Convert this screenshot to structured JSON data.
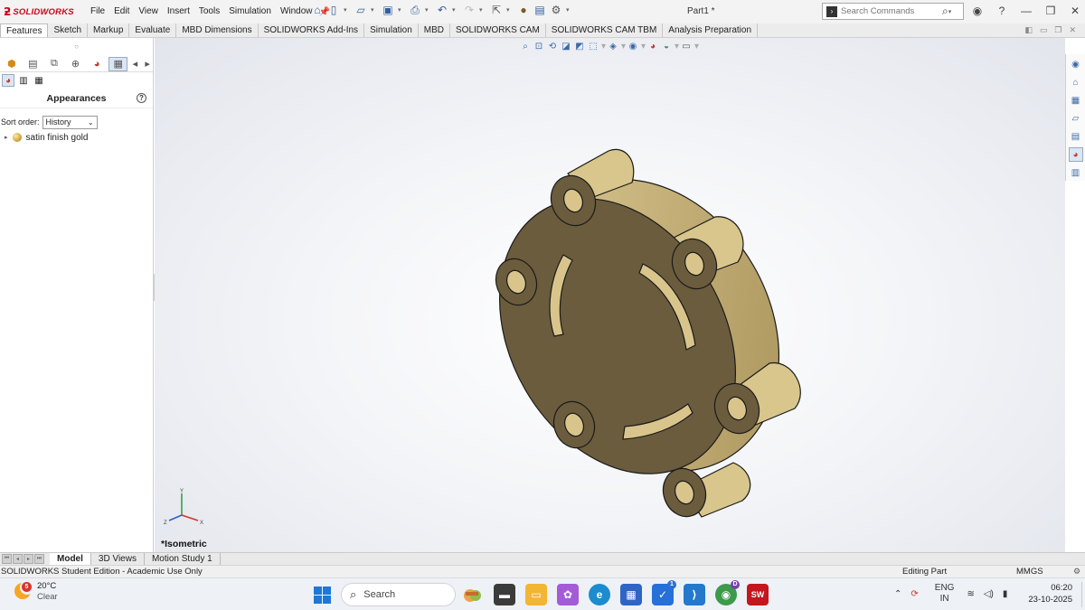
{
  "app": {
    "brand": "SOLIDWORKS",
    "document_title": "Part1 *",
    "menu": [
      "File",
      "Edit",
      "View",
      "Insert",
      "Tools",
      "Simulation",
      "Window"
    ],
    "search_placeholder": "Search Commands"
  },
  "command_tabs": [
    "Features",
    "Sketch",
    "Markup",
    "Evaluate",
    "MBD Dimensions",
    "SOLIDWORKS Add-Ins",
    "Simulation",
    "MBD",
    "SOLIDWORKS CAM",
    "SOLIDWORKS CAM TBM",
    "Analysis Preparation"
  ],
  "active_command_tab": "Features",
  "left_panel": {
    "title": "Appearances",
    "help_label": "?",
    "sort_label": "Sort order:",
    "sort_value": "History",
    "tree_items": [
      {
        "label": "satin finish gold",
        "icon": "gold-sphere-icon"
      }
    ]
  },
  "viewport": {
    "view_label": "*Isometric",
    "triad_labels": {
      "x": "X",
      "y": "Y",
      "z": "Z"
    },
    "part_color": "#c9b47a",
    "face_color": "#6b5c3d"
  },
  "bottom_tabs": [
    "Model",
    "3D Views",
    "Motion Study 1"
  ],
  "active_bottom_tab": "Model",
  "status": {
    "left": "SOLIDWORKS Student Edition - Academic Use Only",
    "mode": "Editing Part",
    "units": "MMGS"
  },
  "taskbar": {
    "weather_temp": "20°C",
    "weather_cond": "Clear",
    "weather_badge": "5",
    "search_label": "Search",
    "apps": [
      {
        "name": "widgets",
        "color": "#e8a54b",
        "glyph": ""
      },
      {
        "name": "terminal",
        "color": "#3b3b3b",
        "glyph": "▬"
      },
      {
        "name": "file-explorer",
        "color": "#f2b632",
        "glyph": "▭"
      },
      {
        "name": "copilot",
        "color": "#a35bd8",
        "glyph": "✿"
      },
      {
        "name": "edge",
        "color": "#1a8ccf",
        "glyph": "e"
      },
      {
        "name": "store",
        "color": "#2e64c4",
        "glyph": "▦"
      },
      {
        "name": "todo",
        "color": "#2670d9",
        "glyph": "✓",
        "badge": "1"
      },
      {
        "name": "vscode",
        "color": "#2479cc",
        "glyph": "⟩"
      },
      {
        "name": "chrome",
        "color": "#3d9a4a",
        "glyph": "◉",
        "badge": "D"
      },
      {
        "name": "solidworks",
        "color": "#c4161c",
        "glyph": "SW"
      }
    ],
    "lang_top": "ENG",
    "lang_bottom": "IN",
    "time": "06:20",
    "date": "23-10-2025"
  }
}
